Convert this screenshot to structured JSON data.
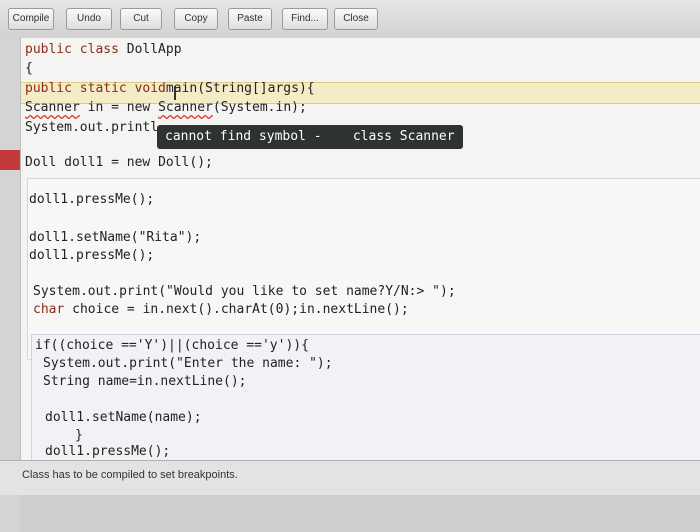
{
  "toolbar": {
    "buttons": [
      {
        "label": "Compile"
      },
      {
        "label": "Undo"
      },
      {
        "label": "Cut"
      },
      {
        "label": "Copy"
      },
      {
        "label": "Paste"
      },
      {
        "label": "Find..."
      },
      {
        "label": "Close"
      }
    ]
  },
  "code": {
    "l1_kw": "public class",
    "l1_rest": " DollApp",
    "l2": "{",
    "l3_kw": "public static void",
    "l3_rest": "main(String[]args){",
    "l4_a": "Scanner",
    "l4_b": " in = new ",
    "l4_c": "Scanner",
    "l4_d": "(System.in);",
    "l5": "System.out.printl",
    "l6_a": "Doll",
    "l6_b": " doll1 = new ",
    "l6_c": "Doll",
    "l6_d": "();",
    "l7": "doll1.pressMe();",
    "l8": "doll1.setName(\"Rita\");",
    "l9": "doll1.pressMe();",
    "l10": "System.out.print(\"Would you like to set name?Y/N:> \");",
    "l11_kw": "char",
    "l11_rest": " choice = in.next().charAt(0);in.nextLine();",
    "l12": "if((choice =='Y')||(choice =='y')){",
    "l13": "System.out.print(\"Enter the name: \");",
    "l14": "String name=in.nextLine();",
    "l15": "doll1.setName(name);",
    "l16": "}",
    "l17": "doll1.pressMe();"
  },
  "tooltip": {
    "text": "cannot find symbol -    class Scanner"
  },
  "status": {
    "text": "Class has to be compiled to set breakpoints."
  },
  "colors": {
    "keyword": "#8a2c1a",
    "error": "#c23a3a",
    "current_line": "#f3ecc7"
  }
}
